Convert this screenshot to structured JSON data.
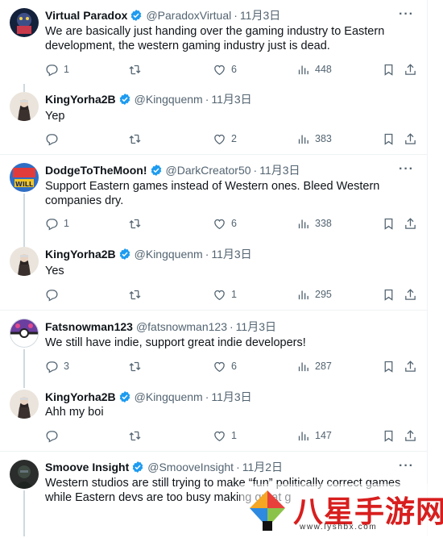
{
  "tweets": [
    {
      "name": "Virtual Paradox",
      "handle": "@ParadoxVirtual",
      "date": "11月3日",
      "text": "We are basically just handing over the gaming industry to Eastern development, the western gaming industry just is dead.",
      "replies": "1",
      "retweets": "",
      "likes": "6",
      "views": "448"
    },
    {
      "name": "KingYorha2B",
      "handle": "@Kingquenm",
      "date": "11月3日",
      "text": "Yep",
      "replies": "",
      "retweets": "",
      "likes": "2",
      "views": "383"
    },
    {
      "name": "DodgeToTheMoon!",
      "handle": "@DarkCreator50",
      "date": "11月3日",
      "text": "Support Eastern games instead of Western ones. Bleed Western companies dry.",
      "replies": "1",
      "retweets": "",
      "likes": "6",
      "views": "338"
    },
    {
      "name": "KingYorha2B",
      "handle": "@Kingquenm",
      "date": "11月3日",
      "text": "Yes",
      "replies": "",
      "retweets": "",
      "likes": "1",
      "views": "295"
    },
    {
      "name": "Fatsnowman123",
      "handle": "@fatsnowman123",
      "date": "11月3日",
      "text": "We still have indie, support great indie developers!",
      "replies": "3",
      "retweets": "",
      "likes": "6",
      "views": "287"
    },
    {
      "name": "KingYorha2B",
      "handle": "@Kingquenm",
      "date": "11月3日",
      "text": "Ahh my boi",
      "replies": "",
      "retweets": "",
      "likes": "1",
      "views": "147"
    },
    {
      "name": "Smoove Insight",
      "handle": "@SmooveInsight",
      "date": "11月2日",
      "text": "Western studios are still trying to make “fun” politically correct games while Eastern devs are too busy making great g"
    }
  ],
  "separator_dot": "·",
  "more_label": "···",
  "colors": {
    "text": "#0f1419",
    "muted": "#536471",
    "verified": "#1d9bf0",
    "separator": "#eff3f4",
    "thread_line": "#cfd9de",
    "watermark_red": "#d81e1e"
  },
  "watermark": {
    "title": "八星手游网",
    "url": "www.lyshbx.com"
  }
}
